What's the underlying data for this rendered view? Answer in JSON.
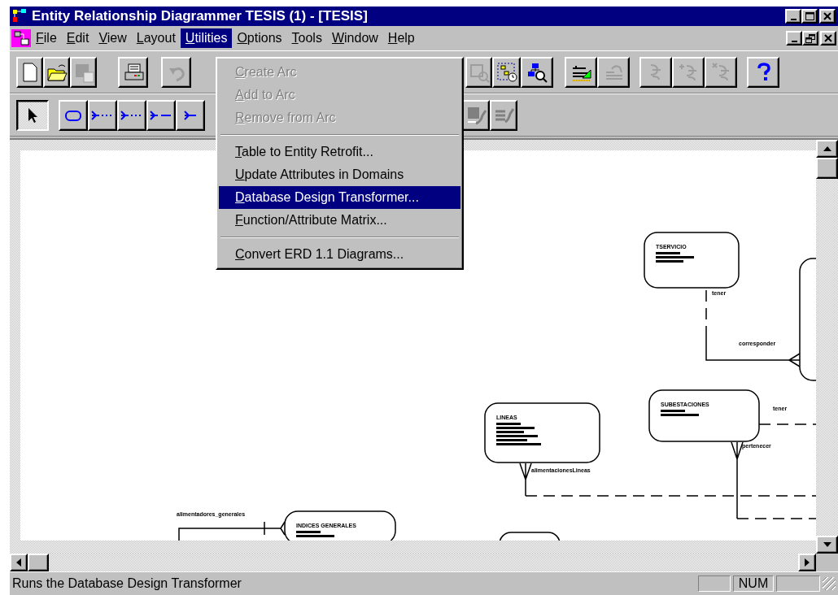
{
  "window": {
    "title": "Entity Relationship Diagrammer TESIS (1) - [TESIS]"
  },
  "menu_bar": [
    {
      "label": "File",
      "selected": false
    },
    {
      "label": "Edit",
      "selected": false
    },
    {
      "label": "View",
      "selected": false
    },
    {
      "label": "Layout",
      "selected": false
    },
    {
      "label": "Utilities",
      "selected": true
    },
    {
      "label": "Options",
      "selected": false
    },
    {
      "label": "Tools",
      "selected": false
    },
    {
      "label": "Window",
      "selected": false
    },
    {
      "label": "Help",
      "selected": false
    }
  ],
  "toolbar": [
    {
      "disabled": false
    },
    {
      "disabled": false
    },
    {
      "disabled": true
    },
    {
      "disabled": false
    },
    {
      "disabled": true
    },
    {
      "disabled": true
    },
    {
      "disabled": false
    },
    {
      "disabled": false
    },
    {
      "disabled": false
    },
    {
      "disabled": true
    },
    {
      "disabled": true
    },
    {
      "disabled": true
    },
    {
      "disabled": true
    },
    {
      "disabled": false
    }
  ],
  "drawing_toolbar": [
    {
      "selected": true
    },
    {
      "selected": false
    },
    {
      "selected": false
    },
    {
      "selected": false
    },
    {
      "selected": false
    },
    {
      "selected": false
    },
    {
      "selected": false
    },
    {
      "selected": false
    }
  ],
  "utilities_menu": [
    {
      "kind": "item",
      "label": "Create Arc",
      "disabled": true,
      "selected": false
    },
    {
      "kind": "item",
      "label": "Add to Arc",
      "disabled": true,
      "selected": false
    },
    {
      "kind": "item",
      "label": "Remove from Arc",
      "disabled": true,
      "selected": false
    },
    {
      "kind": "separator"
    },
    {
      "kind": "item",
      "label": "Table to Entity Retrofit...",
      "disabled": false,
      "selected": false
    },
    {
      "kind": "item",
      "label": "Update Attributes in Domains",
      "disabled": false,
      "selected": false
    },
    {
      "kind": "item",
      "label": "Database Design Transformer...",
      "disabled": false,
      "selected": true
    },
    {
      "kind": "item",
      "label": "Function/Attribute Matrix...",
      "disabled": false,
      "selected": false
    },
    {
      "kind": "separator"
    },
    {
      "kind": "item",
      "label": "Convert ERD 1.1 Diagrams...",
      "disabled": false,
      "selected": false
    }
  ],
  "diagram": {
    "entities": [
      {
        "name": "TSERVICIO"
      },
      {
        "name": "SUBESTACIONES"
      },
      {
        "name": "LINEAS"
      },
      {
        "name": "INDICES GENERALES"
      }
    ],
    "relationships": [
      {
        "label": "tener"
      },
      {
        "label": "corresponder"
      },
      {
        "label": "tener"
      },
      {
        "label": "pertenecer"
      },
      {
        "label": "alimentacionesLineas"
      },
      {
        "label": "alimentadores_generales"
      }
    ]
  },
  "status_bar": {
    "message": "Runs the Database Design Transformer",
    "indicators": [
      "NUM"
    ]
  }
}
